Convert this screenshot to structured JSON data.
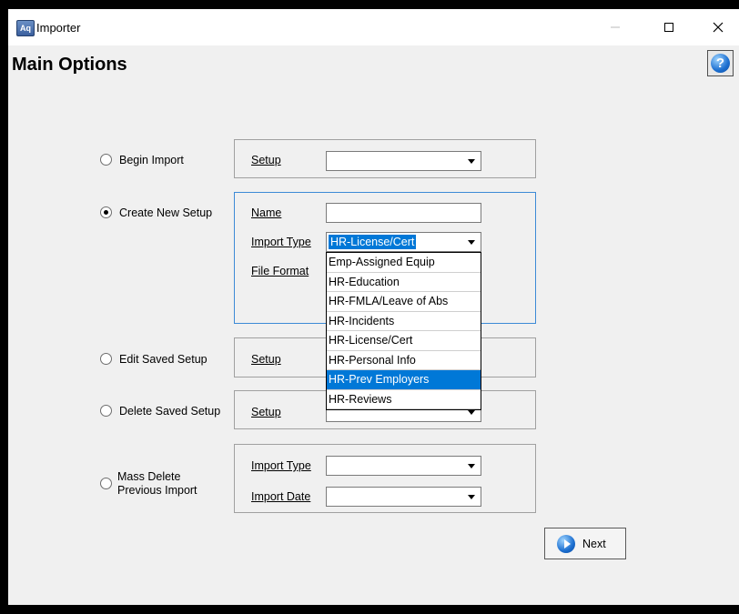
{
  "window": {
    "title": "Importer",
    "icon": "importer-app-icon",
    "controls": [
      "minimize-icon",
      "maximize-icon",
      "close-icon"
    ]
  },
  "page": {
    "title": "Main Options",
    "help_icon": "help-icon",
    "help_glyph": "?"
  },
  "options": {
    "begin_import": {
      "label": "Begin Import",
      "setup_label": "Setup",
      "setup_value": "",
      "checked": false
    },
    "create_new_setup": {
      "label": "Create New Setup",
      "checked": true,
      "name_label": "Name",
      "name_value": "",
      "import_type_label": "Import Type",
      "import_type_value": "HR-License/Cert",
      "file_format_label": "File Format"
    },
    "edit_saved_setup": {
      "label": "Edit Saved Setup",
      "setup_label": "Setup",
      "setup_value": "",
      "checked": false
    },
    "delete_saved_setup": {
      "label": "Delete Saved Setup",
      "setup_label": "Setup",
      "setup_value": "",
      "checked": false
    },
    "mass_delete": {
      "label_line1": "Mass Delete",
      "label_line2": "Previous Import",
      "checked": false,
      "import_type_label": "Import Type",
      "import_type_value": "",
      "import_date_label": "Import Date",
      "import_date_value": ""
    }
  },
  "import_type_dropdown": {
    "open": true,
    "highlighted": "HR-Prev Employers",
    "items": [
      "Emp-Assigned Equip",
      "HR-Education",
      "HR-FMLA/Leave of Abs",
      "HR-Incidents",
      "HR-License/Cert",
      "HR-Personal Info",
      "HR-Prev Employers",
      "HR-Reviews"
    ]
  },
  "buttons": {
    "next_label": "Next",
    "next_icon": "next-arrow-icon"
  },
  "colors": {
    "selection": "#0078d7",
    "focus_border": "#3c8ad6",
    "window_bg": "#f0f0f0"
  }
}
